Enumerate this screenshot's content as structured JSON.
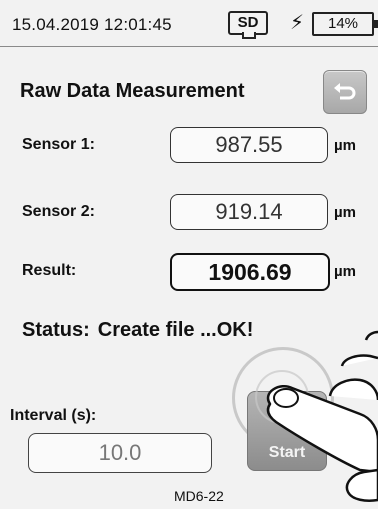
{
  "status_bar": {
    "datetime": "15.04.2019 12:01:45",
    "sd_label": "SD",
    "battery": "14%"
  },
  "screen": {
    "title": "Raw Data Measurement",
    "rows": [
      {
        "label": "Sensor 1:",
        "value": "987.55",
        "unit": "µm"
      },
      {
        "label": "Sensor 2:",
        "value": "919.14",
        "unit": "µm"
      },
      {
        "label": "Result:",
        "value": "1906.69",
        "unit": "µm"
      }
    ],
    "status_label": "Status:",
    "status_value": "Create file ...OK!",
    "interval_label": "Interval (s):",
    "interval_value": "10.0",
    "start_label": "Start",
    "model": "MD6-22"
  },
  "icons": {
    "back": "back-arrow-icon",
    "charging": "lightning-icon",
    "sd": "sd-card-icon",
    "battery": "battery-icon"
  }
}
